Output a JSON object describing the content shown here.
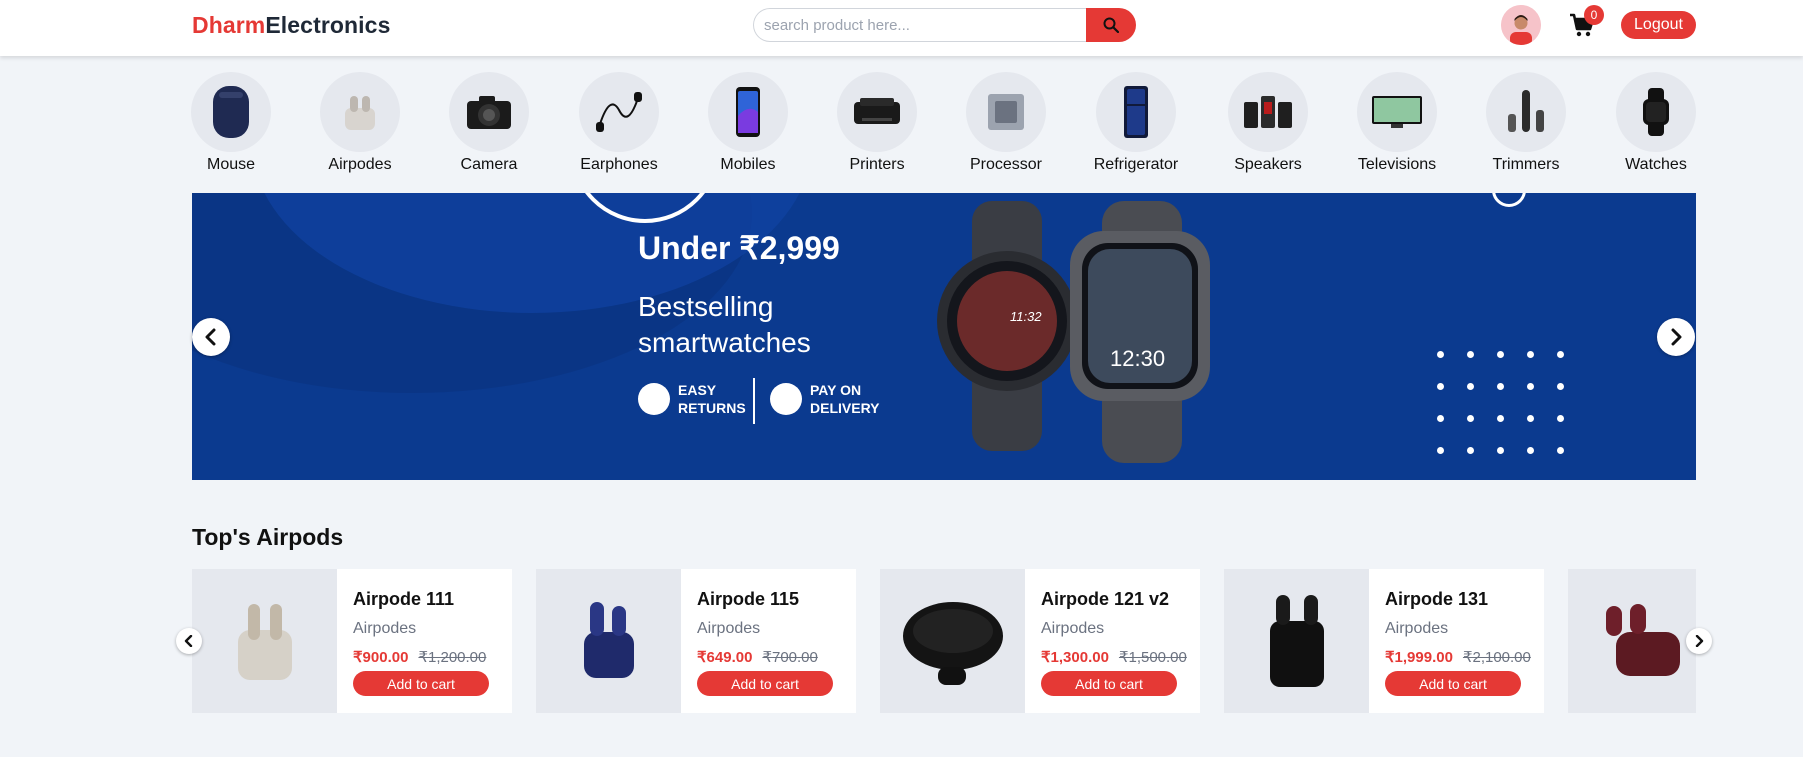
{
  "header": {
    "logo_part1": "Dharm",
    "logo_part2": "Electronics",
    "search_placeholder": "search product here...",
    "cart_count": "0",
    "logout_label": "Logout"
  },
  "categories": [
    {
      "label": "Mouse"
    },
    {
      "label": "Airpodes"
    },
    {
      "label": "Camera"
    },
    {
      "label": "Earphones"
    },
    {
      "label": "Mobiles"
    },
    {
      "label": "Printers"
    },
    {
      "label": "Processor"
    },
    {
      "label": "Refrigerator"
    },
    {
      "label": "Speakers"
    },
    {
      "label": "Televisions"
    },
    {
      "label": "Trimmers"
    },
    {
      "label": "Watches"
    }
  ],
  "banner": {
    "price_line": "Under ₹2,999",
    "headline_1": "Bestselling",
    "headline_2": "smartwatches",
    "feature_1_line1": "EASY",
    "feature_1_line2": "RETURNS",
    "feature_2_line1": "PAY ON",
    "feature_2_line2": "DELIVERY",
    "watch_time_1": "11:32",
    "watch_time_2": "12:30"
  },
  "section": {
    "title": "Top's Airpods",
    "products": [
      {
        "name": "Airpode 111",
        "category": "Airpodes",
        "price": "₹900.00",
        "mrp": "₹1,200.00",
        "cta": "Add to cart"
      },
      {
        "name": "Airpode 115",
        "category": "Airpodes",
        "price": "₹649.00",
        "mrp": "₹700.00",
        "cta": "Add to cart"
      },
      {
        "name": "Airpode 121 v2",
        "category": "Airpodes",
        "price": "₹1,300.00",
        "mrp": "₹1,500.00",
        "cta": "Add to cart"
      },
      {
        "name": "Airpode 131",
        "category": "Airpodes",
        "price": "₹1,999.00",
        "mrp": "₹2,100.00",
        "cta": "Add to cart"
      }
    ]
  },
  "colors": {
    "accent": "#e53935",
    "banner_bg": "#0b3a8f",
    "page_bg": "#f1f4f8"
  }
}
